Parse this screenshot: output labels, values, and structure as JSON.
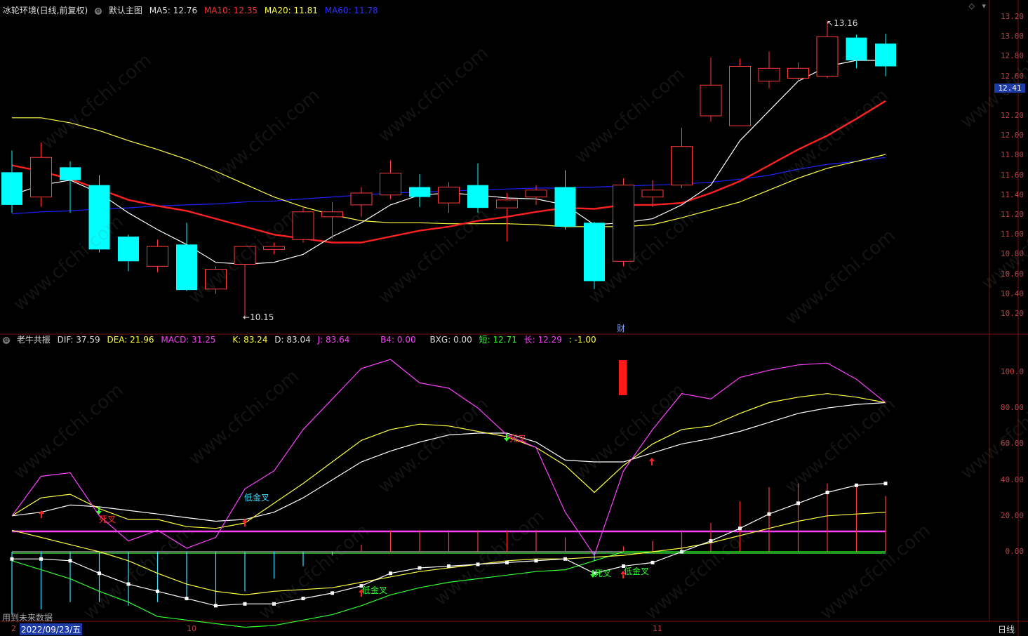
{
  "header": {
    "stock_name": "冰轮环境(日线,前复权)",
    "template": "默认主图",
    "ma5": {
      "label": "MA5: ",
      "value": "12.76"
    },
    "ma10": {
      "label": "MA10: ",
      "value": "12.35"
    },
    "ma20": {
      "label": "MA20: ",
      "value": "11.81"
    },
    "ma60": {
      "label": "MA60: ",
      "value": "11.78"
    }
  },
  "indicator_header": {
    "name": "老牛共振",
    "dif": {
      "label": "DIF: ",
      "value": "37.59"
    },
    "dea": {
      "label": "DEA: ",
      "value": "21.96"
    },
    "macd": {
      "label": "MACD: ",
      "value": "31.25"
    },
    "k": {
      "label": "K: ",
      "value": "83.24"
    },
    "d": {
      "label": "D: ",
      "value": "83.04"
    },
    "j": {
      "label": "J: ",
      "value": "83.64"
    },
    "b4": {
      "label": "B4: ",
      "value": "0.00"
    },
    "bxg": {
      "label": "BXG: ",
      "value": "0.00"
    },
    "short": {
      "label": "短: ",
      "value": "12.71"
    },
    "long": {
      "label": "长: ",
      "value": "12.29"
    },
    "extra": ": -1.00"
  },
  "price_axis": [
    "13.20",
    "13.00",
    "12.80",
    "12.60",
    "12.41",
    "12.20",
    "12.00",
    "11.80",
    "11.60",
    "11.40",
    "11.20",
    "11.00",
    "10.80",
    "10.60",
    "10.40",
    "10.20"
  ],
  "current_price": "12.41",
  "ind_axis": [
    "100.0",
    "80.00",
    "60.00",
    "40.00",
    "20.00",
    "0.00"
  ],
  "annotations": {
    "high": "13.16",
    "low": "10.15",
    "fin_marker": "财",
    "low_golden_cross": "低金叉",
    "death_cross": "死叉"
  },
  "bottom": {
    "future_data": "用到未来数据",
    "date_cursor": "2022/09/23/五",
    "month_10": "10",
    "month_11": "11",
    "period": "日线",
    "left_cut": "2"
  },
  "watermark": "www.cfchi.com",
  "colors": {
    "up": "#ff3b3b",
    "down": "#00ffff",
    "ma5": "#ffffff",
    "ma10": "#ff2020",
    "ma20": "#ffff40",
    "ma60": "#2020ff",
    "magenta": "#ff40ff",
    "grid": "#7a1010"
  },
  "chart_data": {
    "type": "candlestick",
    "ylim": [
      10.1,
      13.25
    ],
    "candles": [
      {
        "o": 11.63,
        "h": 11.85,
        "l": 11.22,
        "c": 11.3
      },
      {
        "o": 11.38,
        "h": 11.93,
        "l": 11.28,
        "c": 11.78
      },
      {
        "o": 11.68,
        "h": 11.74,
        "l": 11.22,
        "c": 11.55
      },
      {
        "o": 11.5,
        "h": 11.6,
        "l": 10.82,
        "c": 10.85
      },
      {
        "o": 10.98,
        "h": 11.0,
        "l": 10.63,
        "c": 10.73
      },
      {
        "o": 10.68,
        "h": 10.95,
        "l": 10.62,
        "c": 10.88
      },
      {
        "o": 10.9,
        "h": 11.12,
        "l": 10.43,
        "c": 10.44
      },
      {
        "o": 10.45,
        "h": 10.68,
        "l": 10.4,
        "c": 10.65
      },
      {
        "o": 10.7,
        "h": 10.88,
        "l": 10.15,
        "c": 10.88
      },
      {
        "o": 10.85,
        "h": 10.92,
        "l": 10.8,
        "c": 10.88
      },
      {
        "o": 10.95,
        "h": 11.28,
        "l": 10.92,
        "c": 11.23
      },
      {
        "o": 11.18,
        "h": 11.33,
        "l": 10.96,
        "c": 11.23
      },
      {
        "o": 11.3,
        "h": 11.48,
        "l": 11.18,
        "c": 11.42
      },
      {
        "o": 11.4,
        "h": 11.75,
        "l": 11.36,
        "c": 11.62
      },
      {
        "o": 11.48,
        "h": 11.61,
        "l": 11.28,
        "c": 11.38
      },
      {
        "o": 11.32,
        "h": 11.53,
        "l": 11.22,
        "c": 11.48
      },
      {
        "o": 11.5,
        "h": 11.72,
        "l": 11.22,
        "c": 11.27
      },
      {
        "o": 11.27,
        "h": 11.42,
        "l": 10.93,
        "c": 11.35
      },
      {
        "o": 11.38,
        "h": 11.5,
        "l": 11.3,
        "c": 11.45
      },
      {
        "o": 11.48,
        "h": 11.65,
        "l": 11.05,
        "c": 11.08
      },
      {
        "o": 11.12,
        "h": 11.13,
        "l": 10.45,
        "c": 10.53
      },
      {
        "o": 10.73,
        "h": 11.57,
        "l": 10.68,
        "c": 11.5
      },
      {
        "o": 11.38,
        "h": 11.55,
        "l": 11.28,
        "c": 11.45
      },
      {
        "o": 11.5,
        "h": 12.08,
        "l": 11.47,
        "c": 11.89
      },
      {
        "o": 12.2,
        "h": 12.79,
        "l": 12.14,
        "c": 12.51
      },
      {
        "o": 12.1,
        "h": 12.78,
        "l": 12.1,
        "c": 12.7
      },
      {
        "o": 12.55,
        "h": 12.85,
        "l": 12.48,
        "c": 12.68
      },
      {
        "o": 12.58,
        "h": 12.74,
        "l": 12.54,
        "c": 12.68
      },
      {
        "o": 12.6,
        "h": 13.16,
        "l": 12.58,
        "c": 13.0
      },
      {
        "o": 12.99,
        "h": 13.02,
        "l": 12.68,
        "c": 12.76
      },
      {
        "o": 12.93,
        "h": 13.03,
        "l": 12.6,
        "c": 12.7
      }
    ],
    "ma5": [
      11.4,
      11.5,
      11.55,
      11.42,
      11.22,
      11.05,
      10.9,
      10.72,
      10.7,
      10.72,
      10.8,
      10.98,
      11.12,
      11.3,
      11.4,
      11.42,
      11.4,
      11.37,
      11.36,
      11.3,
      11.1,
      11.12,
      11.16,
      11.3,
      11.5,
      11.95,
      12.25,
      12.55,
      12.7,
      12.76,
      12.76
    ],
    "ma10": [
      11.7,
      11.64,
      11.56,
      11.46,
      11.35,
      11.29,
      11.24,
      11.16,
      11.08,
      11.0,
      10.96,
      10.92,
      10.92,
      10.98,
      11.04,
      11.08,
      11.14,
      11.18,
      11.23,
      11.27,
      11.26,
      11.3,
      11.3,
      11.32,
      11.42,
      11.54,
      11.7,
      11.86,
      12.0,
      12.17,
      12.35
    ],
    "ma20": [
      12.18,
      12.18,
      12.13,
      12.05,
      11.95,
      11.86,
      11.76,
      11.64,
      11.51,
      11.38,
      11.28,
      11.2,
      11.14,
      11.12,
      11.12,
      11.11,
      11.11,
      11.11,
      11.1,
      11.08,
      11.08,
      11.08,
      11.1,
      11.17,
      11.25,
      11.33,
      11.45,
      11.57,
      11.67,
      11.74,
      11.81
    ],
    "ma60": [
      11.21,
      11.23,
      11.24,
      11.26,
      11.27,
      11.29,
      11.3,
      11.31,
      11.33,
      11.34,
      11.36,
      11.38,
      11.4,
      11.42,
      11.43,
      11.44,
      11.45,
      11.46,
      11.47,
      11.47,
      11.48,
      11.49,
      11.5,
      11.51,
      11.53,
      11.56,
      11.6,
      11.66,
      11.71,
      11.74,
      11.78
    ]
  },
  "indicator_data": {
    "ylim": [
      -35,
      110
    ],
    "K": [
      20,
      30,
      32,
      24,
      18,
      18,
      14,
      13,
      16,
      27,
      38,
      50,
      62,
      68,
      71,
      70,
      67,
      64,
      58,
      48,
      33,
      48,
      60,
      68,
      70,
      77,
      83,
      86,
      88,
      86,
      83
    ],
    "D": [
      20,
      22,
      26,
      25,
      23,
      21,
      19,
      17,
      18,
      22,
      30,
      40,
      50,
      56,
      61,
      65,
      66,
      66,
      61,
      51,
      50,
      50,
      55,
      60,
      63,
      67,
      72,
      77,
      80,
      82,
      83
    ],
    "J": [
      20,
      42,
      44,
      20,
      6,
      12,
      2,
      8,
      35,
      45,
      68,
      85,
      102,
      107,
      94,
      91,
      80,
      65,
      58,
      22,
      -2,
      45,
      68,
      88,
      85,
      97,
      101,
      104,
      105,
      96,
      83
    ],
    "hist": [
      -35,
      -32,
      -28,
      -28,
      -30,
      -28,
      -27,
      -30,
      -22,
      -15,
      -8,
      -2,
      4,
      12,
      12,
      12,
      12,
      12,
      12,
      8,
      -5,
      3,
      6,
      12,
      16,
      28,
      36,
      38,
      38,
      36,
      31
    ],
    "white": [
      -4,
      -4,
      -5,
      -12,
      -18,
      -22,
      -26,
      -30,
      -29,
      -29,
      -26,
      -23,
      -19,
      -12,
      -9,
      -8,
      -7,
      -6,
      -5,
      -4,
      -12,
      -8,
      -6,
      0,
      6,
      13,
      21,
      27,
      33,
      37,
      38
    ],
    "yellow": [
      12,
      8,
      4,
      0,
      -5,
      -12,
      -18,
      -22,
      -24,
      -22,
      -21,
      -20,
      -17,
      -14,
      -11,
      -9,
      -7,
      -5,
      -4,
      -4,
      -3,
      -2,
      0,
      2,
      5,
      9,
      13,
      17,
      20,
      21,
      22
    ],
    "green": [
      -5,
      -10,
      -15,
      -22,
      -28,
      -36,
      -38,
      -40,
      -42,
      -41,
      -38,
      -35,
      -30,
      -24,
      -20,
      -17,
      -15,
      -13,
      -11,
      -10,
      -5,
      0,
      0,
      0,
      0,
      0,
      0,
      0,
      0,
      0,
      0
    ]
  }
}
